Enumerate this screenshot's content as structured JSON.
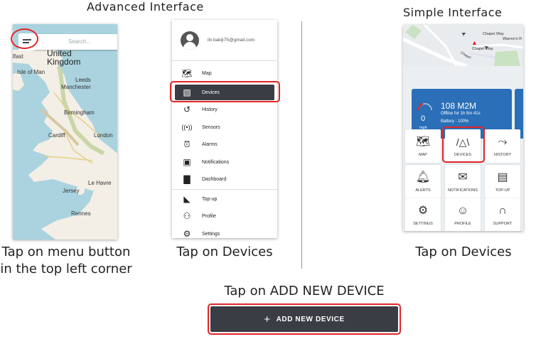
{
  "headers": {
    "advanced": "Advanced Interface",
    "simple": "Simple Interface"
  },
  "advanced_map": {
    "search_placeholder": "Search...",
    "labels": {
      "united_kingdom": "United\nKingdom",
      "isle_of_man": "Isle of Man",
      "leeds": "Leeds",
      "manchester": "Manchester",
      "birmingham": "Birmingham",
      "cardiff": "Cardiff",
      "london": "London",
      "le_havre": "Le Havre",
      "jersey": "Jersey",
      "rennes": "Rennes",
      "belfast": "lfast"
    },
    "caption": "Tap on menu button in the top left corner"
  },
  "drawer": {
    "email": "ilir.bakiji75@gmail.com",
    "items": [
      {
        "label": "Map",
        "icon": "map-icon"
      },
      {
        "label": "Devices",
        "icon": "devices-icon"
      },
      {
        "label": "History",
        "icon": "history-icon"
      },
      {
        "label": "Sensors",
        "icon": "sensors-icon"
      },
      {
        "label": "Alarms",
        "icon": "alarm-clock-icon"
      },
      {
        "label": "Notifications",
        "icon": "notifications-icon"
      },
      {
        "label": "Dashboard",
        "icon": "dashboard-icon"
      },
      {
        "label": "Top-up",
        "icon": "wallet-icon"
      },
      {
        "label": "Profile",
        "icon": "profile-icon"
      },
      {
        "label": "Settings",
        "icon": "settings-icon"
      }
    ],
    "selected": "Devices",
    "caption": "Tap on Devices"
  },
  "simple": {
    "map_labels": {
      "chapel_way": "Chapel Way",
      "warren": "Warren's R",
      "chapel_way2": "Chapel Way",
      "chapel": "Chapel"
    },
    "card": {
      "plate": "108 M2M",
      "status": "Offline for 1h 5m 41s",
      "battery": "Battery : 100%",
      "speed": "0",
      "unit": "mph"
    },
    "tiles": [
      {
        "label": "MAP",
        "icon": "map-icon"
      },
      {
        "label": "DEVICES",
        "icon": "road-icon"
      },
      {
        "label": "HISTORY",
        "icon": "route-icon"
      },
      {
        "label": "ALERTS",
        "icon": "bell-icon"
      },
      {
        "label": "NOTIFICATIONS",
        "icon": "envelope-icon"
      },
      {
        "label": "TOP-UP",
        "icon": "wallet-icon"
      },
      {
        "label": "SETTINGS",
        "icon": "gear-icon"
      },
      {
        "label": "PROFILE",
        "icon": "profile-icon"
      },
      {
        "label": "SUPPORT",
        "icon": "headset-icon"
      }
    ],
    "caption": "Tap on Devices"
  },
  "add_device": {
    "instruction": "Tap on ADD NEW DEVICE",
    "button_label": "ADD NEW DEVICE",
    "icon": "plus-icon"
  },
  "colors": {
    "highlight": "#e12529",
    "button_bg": "#3a3e44",
    "card_bg": "#2a6fb7",
    "sea": "#aad3df",
    "land": "#f3efe6"
  }
}
